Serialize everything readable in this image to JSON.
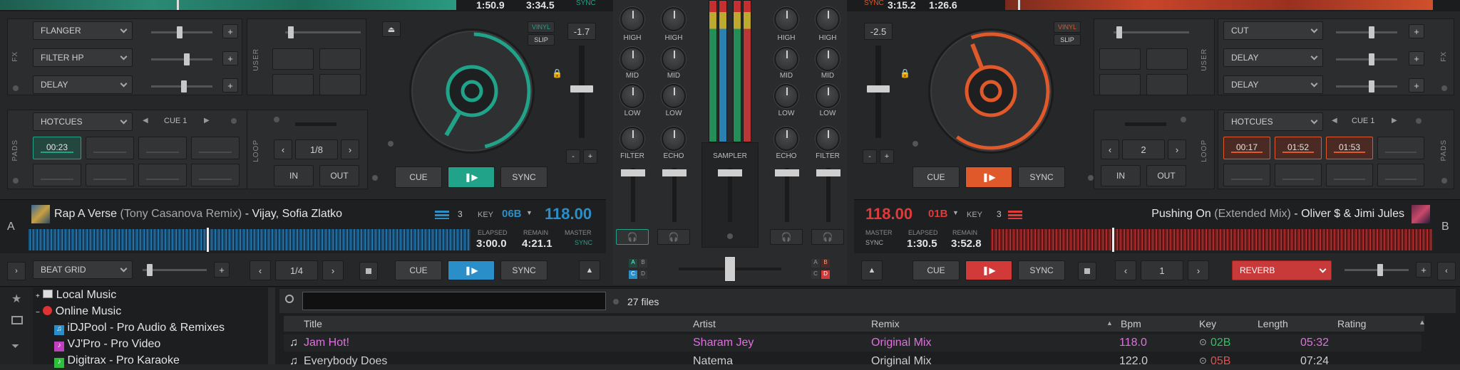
{
  "left_deck": {
    "top_elapsed": "1:50.9",
    "top_remain": "3:34.5",
    "top_sync": "SYNC",
    "fx_label": "FX",
    "fx": [
      "FLANGER",
      "FILTER HP",
      "DELAY"
    ],
    "user_label": "USER",
    "vinyl": "VINYL",
    "slip": "SLIP",
    "pitch": "-1.7",
    "pads_label": "PADS",
    "pad_mode": "HOTCUES",
    "cue_name": "CUE 1",
    "hotcue_1": "00:23",
    "loop_label": "LOOP",
    "loop_size": "1/8",
    "in": "IN",
    "out": "OUT",
    "cue": "CUE",
    "sync": "SYNC",
    "deck_letter": "A",
    "track_title": "Rap A Verse",
    "track_remix": "(Tony Casanova Remix)",
    "track_artist": "- Vijay, Sofia Zlatko",
    "layer_count": "3",
    "key_label": "KEY",
    "key": "06B",
    "bpm": "118.00",
    "elapsed_label": "ELAPSED",
    "remain_label": "REMAIN",
    "master_label": "MASTER",
    "elapsed": "3:00.0",
    "remain": "4:21.1",
    "sync_small": "SYNC",
    "beatgrid": "BEAT GRID",
    "beat_size": "1/4",
    "cue2": "CUE",
    "sync2": "SYNC",
    "accent": "#21a38a",
    "wave_color": "#2a8fc8"
  },
  "right_deck": {
    "top_elapsed": "3:15.2",
    "top_remain": "1:26.6",
    "top_sync": "SYNC",
    "fx_label": "FX",
    "fx": [
      "CUT",
      "DELAY",
      "DELAY"
    ],
    "user_label": "USER",
    "vinyl": "VINYL",
    "slip": "SLIP",
    "pitch": "-2.5",
    "pads_label": "PADS",
    "pad_mode": "HOTCUES",
    "cue_name": "CUE 1",
    "hotcues": [
      "00:17",
      "01:52",
      "01:53"
    ],
    "loop_label": "LOOP",
    "loop_size": "2",
    "in": "IN",
    "out": "OUT",
    "cue": "CUE",
    "sync": "SYNC",
    "deck_letter": "B",
    "track_title": "Pushing On",
    "track_remix": "(Extended Mix)",
    "track_artist": "- Oliver $ & Jimi Jules",
    "layer_count": "3",
    "key_label": "KEY",
    "key": "01B",
    "bpm": "118.00",
    "master_label": "MASTER",
    "elapsed_label": "ELAPSED",
    "remain_label": "REMAIN",
    "elapsed": "1:30.5",
    "remain": "3:52.8",
    "sync_small": "SYNC",
    "beat_size": "1",
    "cue2": "CUE",
    "sync2": "SYNC",
    "effect": "REVERB",
    "accent": "#e0592a",
    "wave_color": "#d23a3a"
  },
  "mixer": {
    "high": "HIGH",
    "mid": "MID",
    "low": "LOW",
    "filter": "FILTER",
    "echo": "ECHO",
    "sampler": "SAMPLER",
    "ch_letters": [
      "A",
      "B",
      "C",
      "D"
    ]
  },
  "browser": {
    "tree": [
      "Local Music",
      "Online Music",
      "iDJPool - Pro Audio & Remixes",
      "VJ'Pro - Pro Video",
      "Digitrax - Pro Karaoke"
    ],
    "search_placeholder": "",
    "file_count": "27 files",
    "columns": [
      "Title",
      "Artist",
      "Remix",
      "Bpm",
      "Key",
      "Length",
      "Rating"
    ],
    "rows": [
      {
        "title": "Jam Hot!",
        "artist": "Sharam Jey",
        "remix": "Original Mix",
        "bpm": "118.0",
        "key": "02B",
        "length": "05:32"
      },
      {
        "title": "Everybody Does",
        "artist": "Natema",
        "remix": "Original Mix",
        "bpm": "122.0",
        "key": "05B",
        "length": "07:24"
      }
    ]
  }
}
